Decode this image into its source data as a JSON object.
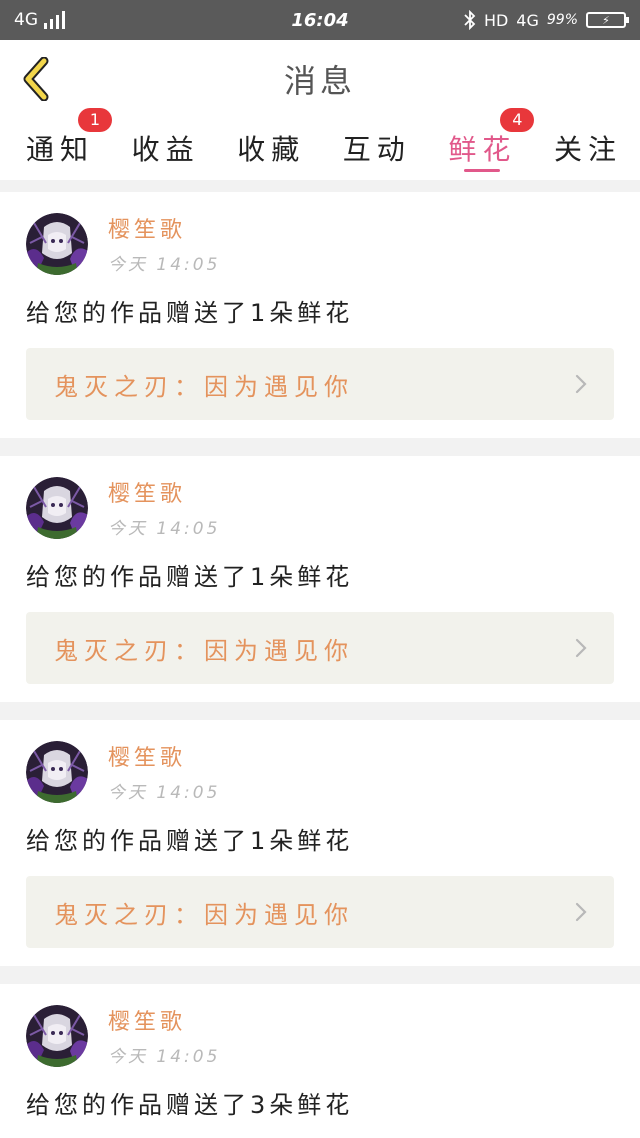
{
  "status_bar": {
    "network": "4G",
    "time": "16:04",
    "bluetooth_icon": "bluetooth-icon",
    "hd": "HD",
    "network_right": "4G",
    "battery": "99%"
  },
  "header": {
    "title": "消息",
    "back_icon": "chevron-left-icon"
  },
  "tabs": [
    {
      "label": "通知",
      "badge": "1",
      "active": false
    },
    {
      "label": "收益",
      "badge": "",
      "active": false
    },
    {
      "label": "收藏",
      "badge": "",
      "active": false
    },
    {
      "label": "互动",
      "badge": "",
      "active": false
    },
    {
      "label": "鲜花",
      "badge": "4",
      "active": true
    },
    {
      "label": "关注",
      "badge": "",
      "active": false
    }
  ],
  "colors": {
    "accent": "#e1588a",
    "name": "#e4935d",
    "badge": "#e8373b"
  },
  "messages": [
    {
      "user": "樱笙歌",
      "time": "今天 14:05",
      "text": "给您的作品赠送了1朵鲜花",
      "work": "鬼灭之刃：因为遇见你"
    },
    {
      "user": "樱笙歌",
      "time": "今天 14:05",
      "text": "给您的作品赠送了1朵鲜花",
      "work": "鬼灭之刃：因为遇见你"
    },
    {
      "user": "樱笙歌",
      "time": "今天 14:05",
      "text": "给您的作品赠送了1朵鲜花",
      "work": "鬼灭之刃：因为遇见你"
    },
    {
      "user": "樱笙歌",
      "time": "今天 14:05",
      "text": "给您的作品赠送了3朵鲜花",
      "work": ""
    }
  ]
}
